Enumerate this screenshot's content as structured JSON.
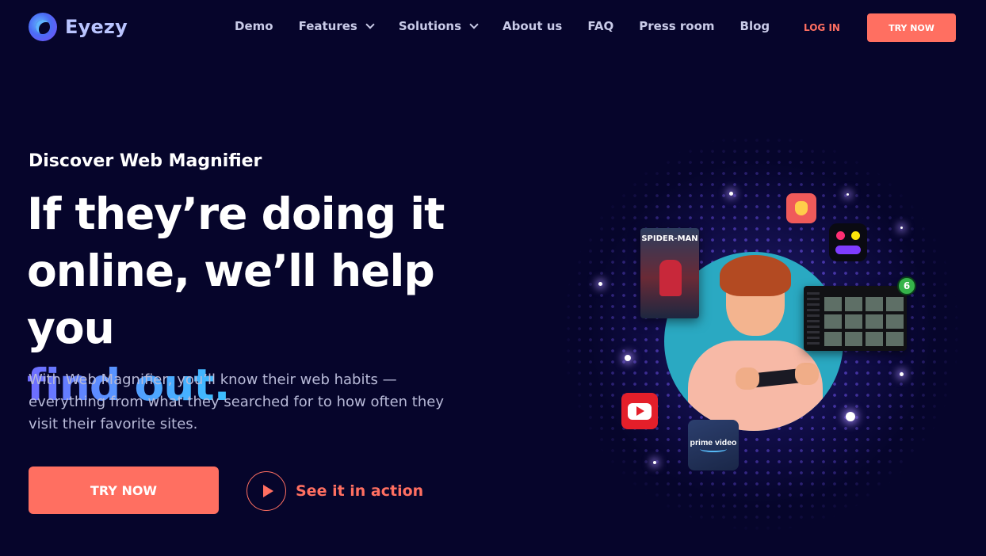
{
  "brand": {
    "name": "Eyezy",
    "accent": "#ff6f61",
    "background": "#06052b"
  },
  "nav": {
    "items": [
      {
        "label": "Demo",
        "has_dropdown": false
      },
      {
        "label": "Features",
        "has_dropdown": true
      },
      {
        "label": "Solutions",
        "has_dropdown": true
      },
      {
        "label": "About us",
        "has_dropdown": false
      },
      {
        "label": "FAQ",
        "has_dropdown": false
      },
      {
        "label": "Press room",
        "has_dropdown": false
      },
      {
        "label": "Blog",
        "has_dropdown": false
      }
    ],
    "login_label": "LOG IN",
    "try_label": "TRY NOW"
  },
  "hero": {
    "eyebrow": "Discover Web Magnifier",
    "headline_line1": "If they’re doing it",
    "headline_line2": "online, we’ll help you",
    "headline_accent": "find out.",
    "description": "With Web Magnifier, you’ll know their web habits — everything from what they searched for to how often they visit their favorite sites.",
    "cta_label": "TRY NOW",
    "secondary_label": "See it in action"
  },
  "illustration": {
    "movie_title": "SPIDER-MAN",
    "notification_count": "6",
    "prime_label": "prime video",
    "icons": [
      "waving-hand-icon",
      "dots-app-icon",
      "youtube-icon",
      "prime-video-icon",
      "play-icon"
    ]
  }
}
